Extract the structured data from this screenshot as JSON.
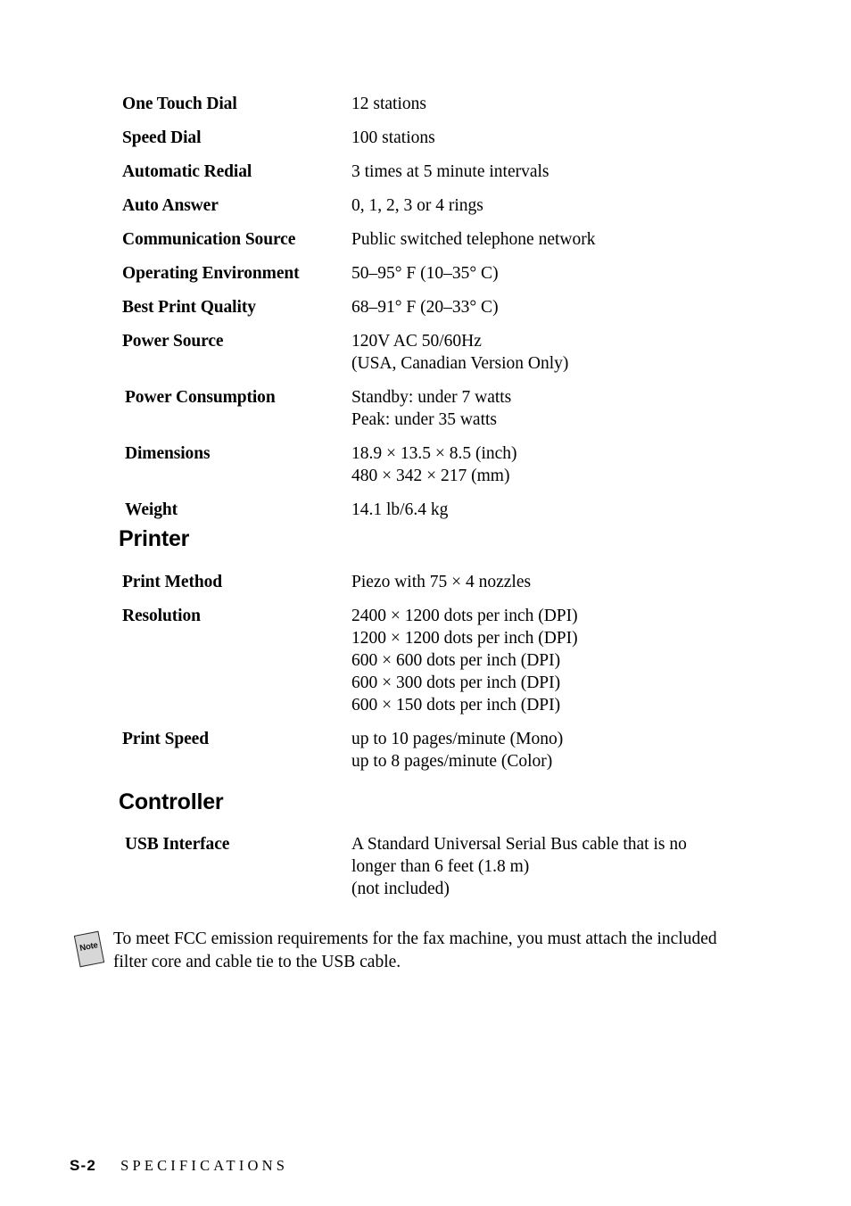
{
  "document": {
    "footer": {
      "page_label": "S-2",
      "section_title": "SPECIFICATIONS"
    }
  },
  "general_specs": [
    {
      "label": "One Touch Dial",
      "value": "12 stations"
    },
    {
      "label": "Speed Dial",
      "value": "100 stations"
    },
    {
      "label": "Automatic Redial",
      "value": "3 times at 5 minute intervals"
    },
    {
      "label": "Auto Answer",
      "value": "0, 1, 2, 3 or 4 rings"
    },
    {
      "label": "Communication Source",
      "value": "Public switched telephone network"
    },
    {
      "label": "Operating Environment",
      "value": "50–95° F (10–35° C)"
    },
    {
      "label": "Best Print Quality",
      "value": "68–91° F (20–33° C)"
    },
    {
      "label": "Power Source",
      "value": "120V AC 50/60Hz\n(USA, Canadian Version Only)"
    },
    {
      "label": "Power Consumption",
      "value": "Standby: under 7 watts\nPeak: under 35 watts"
    },
    {
      "label": "Dimensions",
      "value": "18.9 × 13.5 × 8.5 (inch)\n480 × 342 × 217 (mm)"
    },
    {
      "label": "Weight",
      "value": "14.1 lb/6.4 kg"
    }
  ],
  "printer": {
    "heading": "Printer",
    "specs": [
      {
        "label": "Print Method",
        "value": "Piezo with 75 × 4 nozzles"
      },
      {
        "label": "Resolution",
        "value": "2400 × 1200 dots per inch (DPI)\n1200 × 1200 dots per inch (DPI)\n600 × 600 dots per inch (DPI)\n600 × 300 dots per inch (DPI)\n600 × 150 dots per inch (DPI)"
      },
      {
        "label": "Print Speed",
        "value": "up to 10 pages/minute (Mono)\nup to 8 pages/minute (Color)"
      }
    ]
  },
  "controller": {
    "heading": "Controller",
    "specs": [
      {
        "label": "USB Interface",
        "value": "A Standard Universal Serial Bus cable that is no longer than 6 feet (1.8 m)\n(not included)"
      }
    ]
  },
  "note": {
    "icon_label": "Note",
    "text": "To meet FCC emission requirements for the fax machine, you must attach the included filter core and cable tie to the USB cable."
  }
}
